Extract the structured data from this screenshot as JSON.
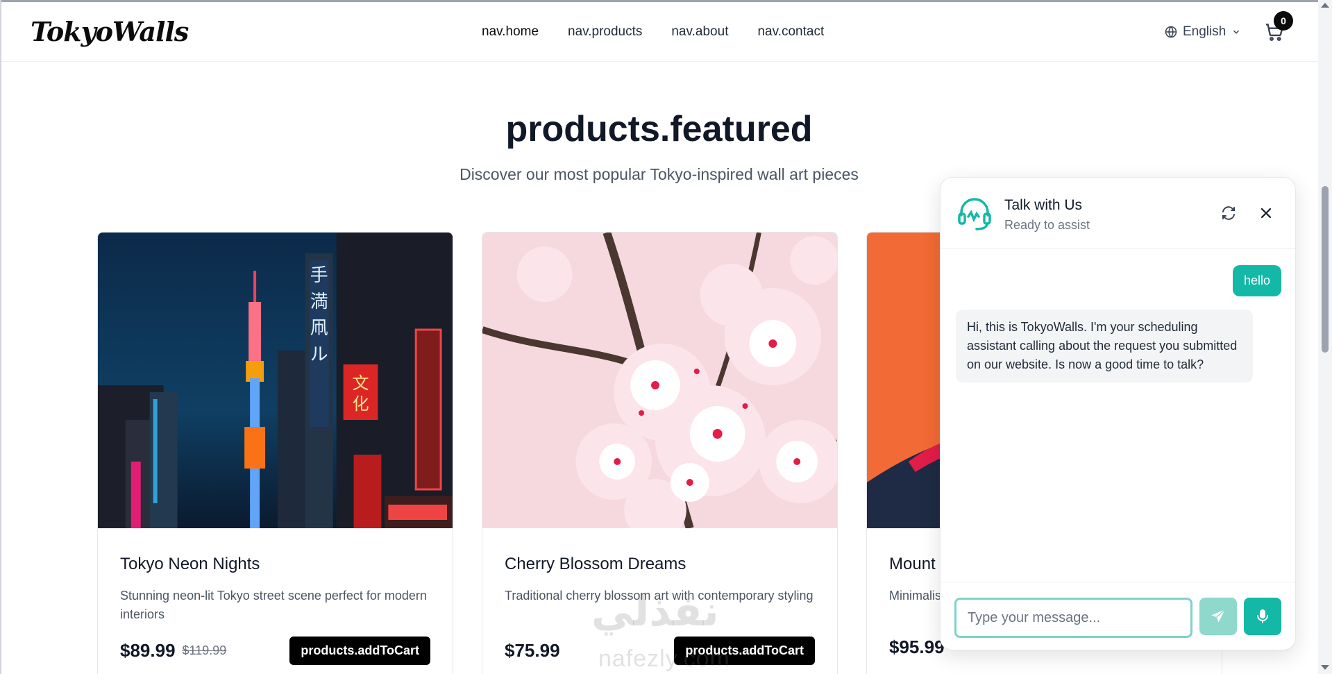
{
  "header": {
    "logo": "TokyoWalls",
    "nav": [
      "nav.home",
      "nav.products",
      "nav.about",
      "nav.contact"
    ],
    "language": "English",
    "cart_count": "0"
  },
  "section": {
    "title": "products.featured",
    "subtitle": "Discover our most popular Tokyo-inspired wall art pieces"
  },
  "products": [
    {
      "name": "Tokyo Neon Nights",
      "description": "Stunning neon-lit Tokyo street scene perfect for modern interiors",
      "price": "$89.99",
      "old_price": "$119.99",
      "button": "products.addToCart"
    },
    {
      "name": "Cherry Blossom Dreams",
      "description": "Traditional cherry blossom art with contemporary styling",
      "price": "$75.99",
      "old_price": "",
      "button": "products.addToCart"
    },
    {
      "name": "Mount",
      "description": "Minimalis",
      "price": "$95.99",
      "old_price": "",
      "button": ""
    }
  ],
  "chat": {
    "title": "Talk with Us",
    "status": "Ready to assist",
    "user_message": "hello",
    "bot_message": "Hi, this is TokyoWalls. I'm your scheduling assistant calling about the request you submitted on our website. Is now a good time to talk?",
    "input_placeholder": "Type your message..."
  },
  "watermark": {
    "arabic": "نفذلي",
    "latin": "nafezly.com"
  },
  "colors": {
    "accent_teal": "#14b8a6",
    "send_disabled": "#8fd8cc",
    "button_black": "#000000"
  }
}
